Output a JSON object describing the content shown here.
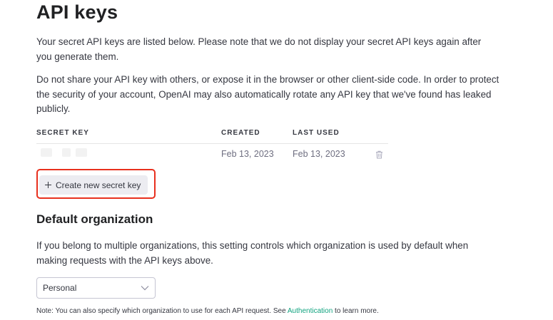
{
  "page": {
    "title": "API keys",
    "intro_1": "Your secret API keys are listed below. Please note that we do not display your secret API keys again after you generate them.",
    "intro_2": "Do not share your API key with others, or expose it in the browser or other client-side code. In order to protect the security of your account, OpenAI may also automatically rotate any API key that we've found has leaked publicly."
  },
  "table": {
    "headers": {
      "secret_key": "SECRET KEY",
      "created": "CREATED",
      "last_used": "LAST USED"
    },
    "rows": [
      {
        "created": "Feb 13, 2023",
        "last_used": "Feb 13, 2023",
        "action_icon": "trash-icon"
      }
    ]
  },
  "actions": {
    "create_label": "Create new secret key",
    "create_icon": "plus-icon"
  },
  "organization": {
    "title": "Default organization",
    "description": "If you belong to multiple organizations, this setting controls which organization is used by default when making requests with the API keys above.",
    "selected": "Personal",
    "note_prefix": "Note: You can also specify which organization to use for each API request. See ",
    "note_link": "Authentication",
    "note_suffix": " to learn more."
  },
  "colors": {
    "highlight": "#e8301e",
    "link": "#10a37f",
    "button_bg": "#ececf1"
  }
}
